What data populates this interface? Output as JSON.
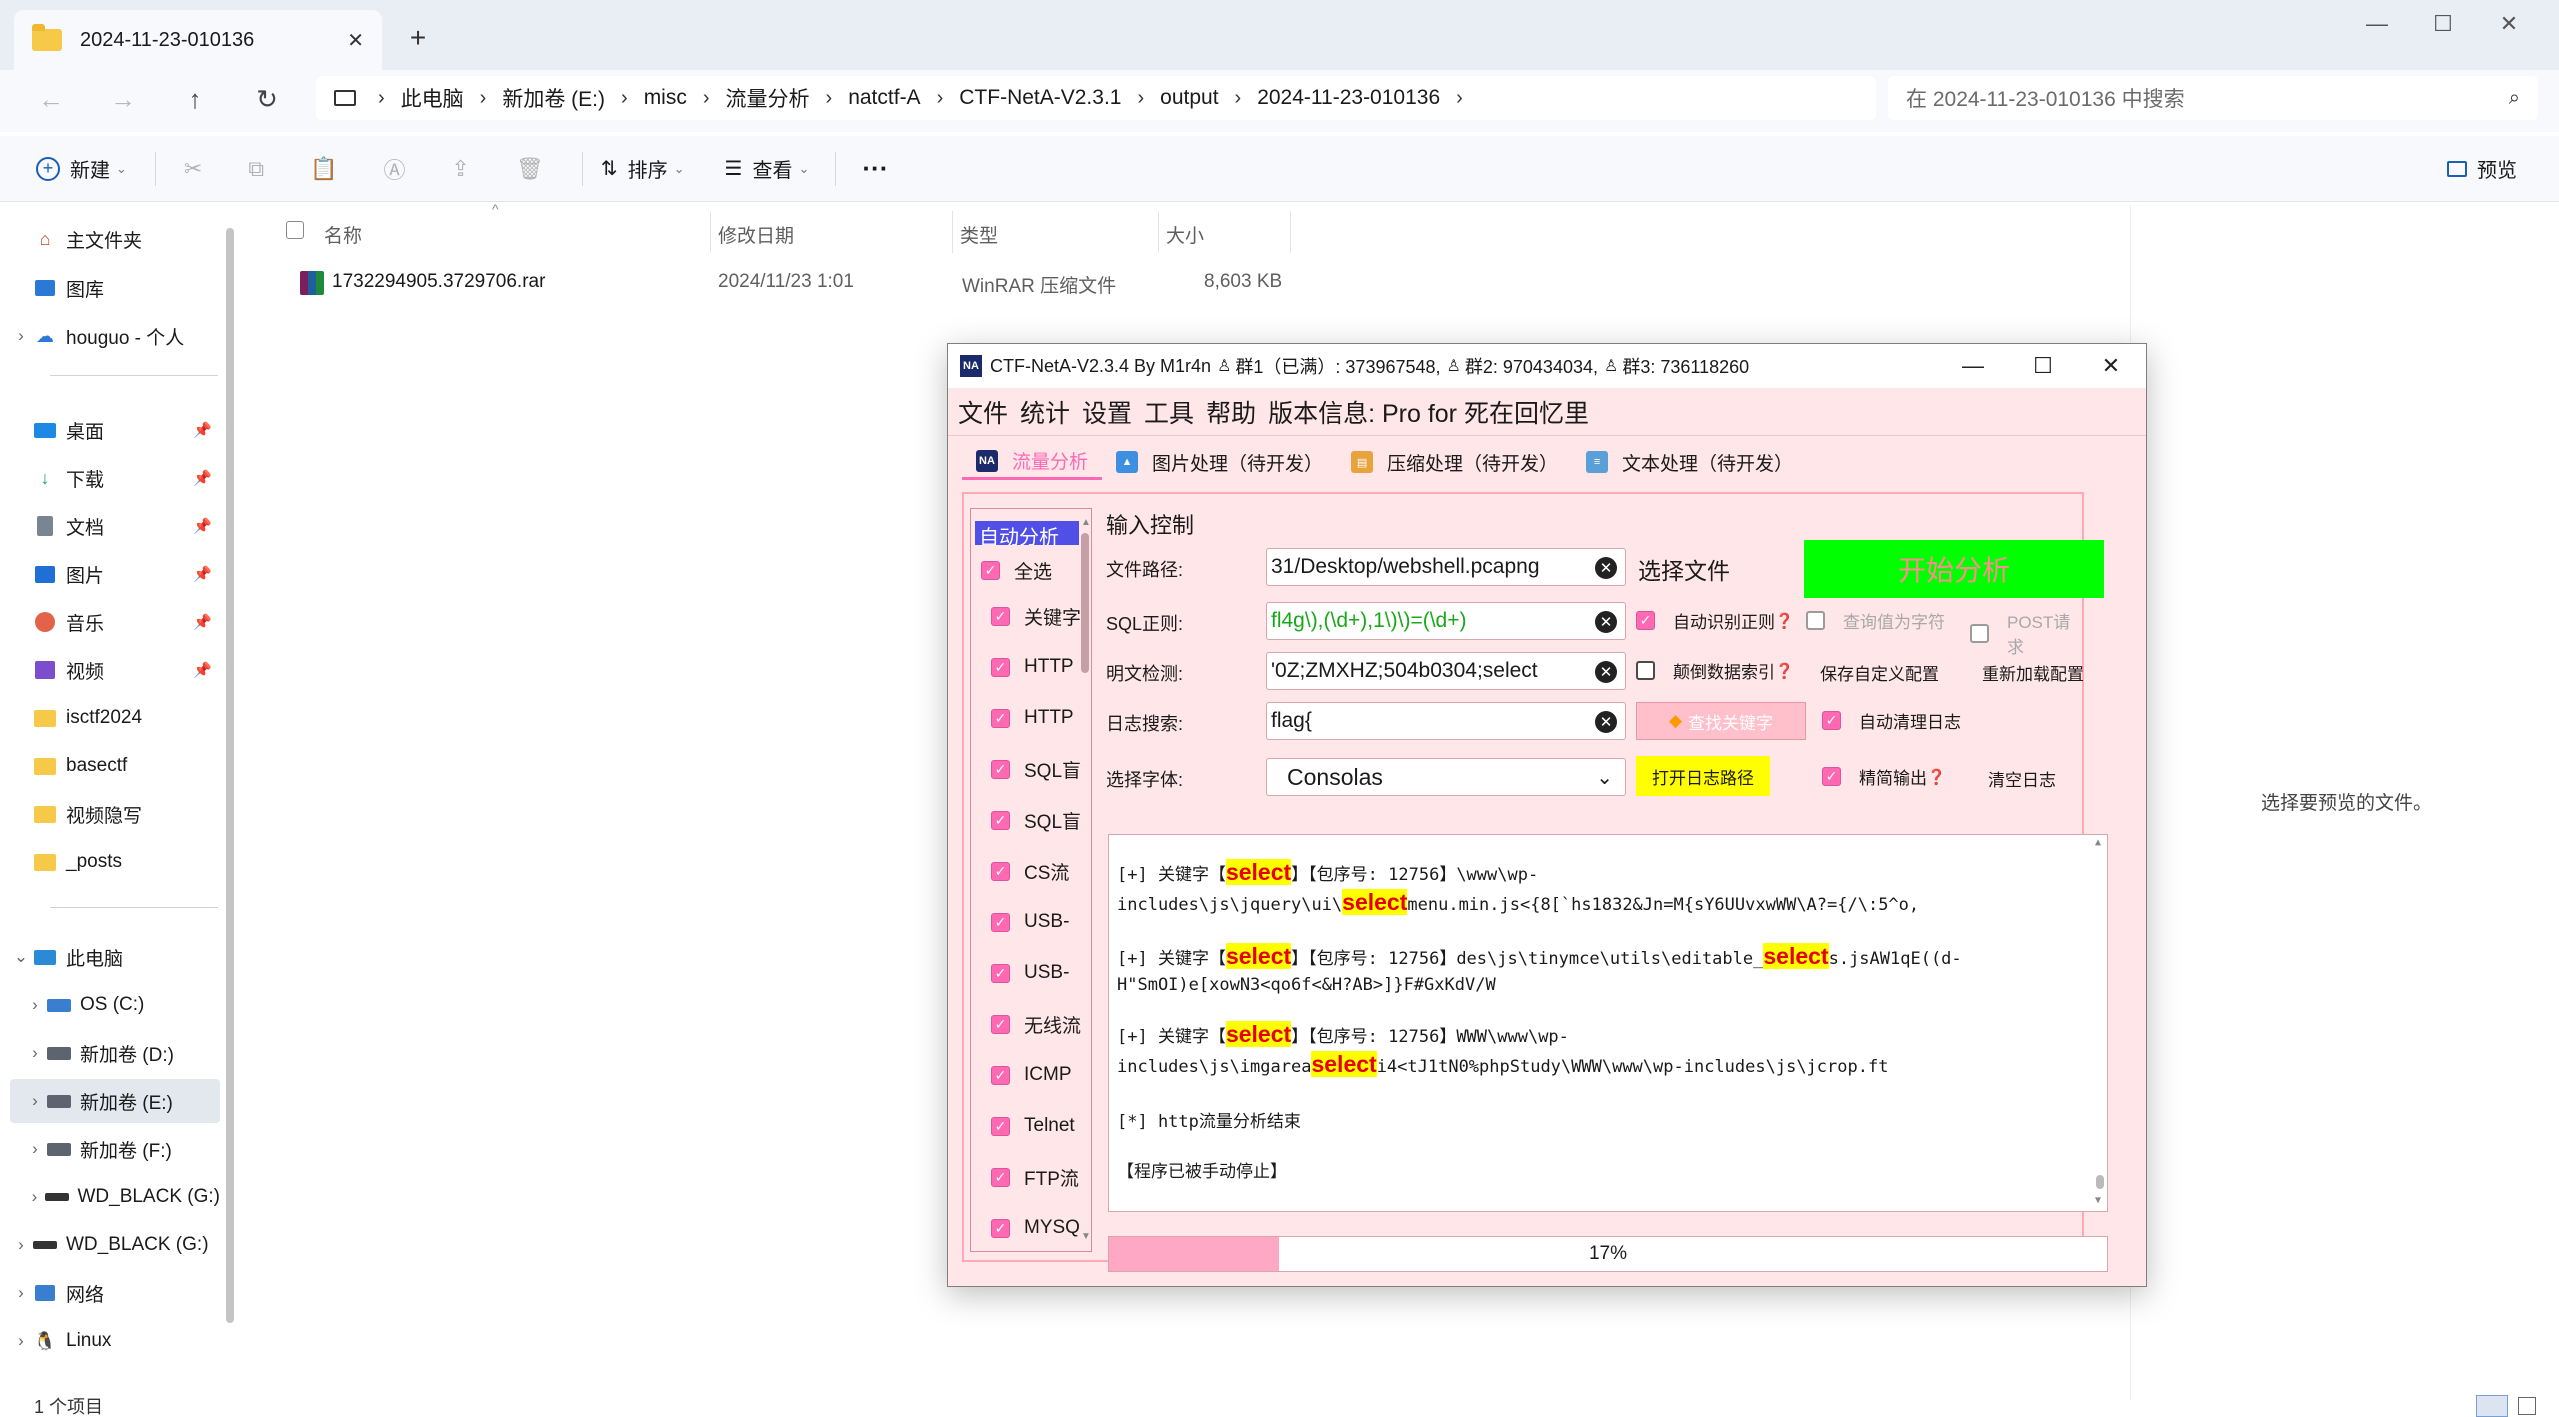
{
  "explorer": {
    "tab_title": "2024-11-23-010136",
    "breadcrumb": [
      "此电脑",
      "新加卷 (E:)",
      "misc",
      "流量分析",
      "natctf-A",
      "CTF-NetA-V2.3.1",
      "output",
      "2024-11-23-010136"
    ],
    "search_placeholder": "在 2024-11-23-010136 中搜索",
    "toolbar": {
      "new": "新建",
      "sort": "排序",
      "view": "查看",
      "more": "···",
      "preview": "预览"
    },
    "sidebar": {
      "top": [
        {
          "label": "主文件夹",
          "icon": "home-icon"
        },
        {
          "label": "图库",
          "icon": "gallery-icon"
        },
        {
          "label": "houguo - 个人",
          "icon": "cloud-icon"
        }
      ],
      "quick": [
        {
          "label": "桌面",
          "icon": "desktop-icon"
        },
        {
          "label": "下载",
          "icon": "download-icon"
        },
        {
          "label": "文档",
          "icon": "document-icon"
        },
        {
          "label": "图片",
          "icon": "pictures-icon"
        },
        {
          "label": "音乐",
          "icon": "music-icon"
        },
        {
          "label": "视频",
          "icon": "video-icon"
        },
        {
          "label": "isctf2024",
          "icon": "folder-icon"
        },
        {
          "label": "basectf",
          "icon": "folder-icon"
        },
        {
          "label": "视频隐写",
          "icon": "folder-icon"
        },
        {
          "label": "_posts",
          "icon": "folder-icon"
        }
      ],
      "pc": "此电脑",
      "drives": [
        {
          "label": "OS (C:)"
        },
        {
          "label": "新加卷 (D:)"
        },
        {
          "label": "新加卷 (E:)"
        },
        {
          "label": "新加卷 (F:)"
        },
        {
          "label": "WD_BLACK (G:)"
        }
      ],
      "bottom": [
        {
          "label": "WD_BLACK (G:)"
        },
        {
          "label": "网络"
        },
        {
          "label": "Linux"
        }
      ]
    },
    "columns": {
      "name": "名称",
      "date": "修改日期",
      "type": "类型",
      "size": "大小"
    },
    "files": [
      {
        "name": "1732294905.3729706.rar",
        "date": "2024/11/23 1:01",
        "type": "WinRAR 压缩文件",
        "size": "8,603 KB"
      }
    ],
    "preview_text": "选择要预览的文件。",
    "status": "1 个项目"
  },
  "neta": {
    "title": "CTF-NetA-V2.3.4 By M1r4n",
    "groups": [
      "群1（已满）: 373967548,",
      "群2: 970434034,",
      "群3: 736118260"
    ],
    "menu": [
      "文件",
      "统计",
      "设置",
      "工具",
      "帮助",
      "版本信息: Pro for 死在回忆里"
    ],
    "tabs": [
      "流量分析",
      "图片处理（待开发）",
      "压缩处理（待开发）",
      "文本处理（待开发）"
    ],
    "options_title": "自动分析",
    "options": [
      "全选",
      "关键字",
      "HTTP",
      "HTTP",
      "SQL盲",
      "SQL盲",
      "CS流",
      "USB-",
      "USB-",
      "无线流",
      "ICMP",
      "Telnet",
      "FTP流",
      "MYSQ"
    ],
    "input_section": "输入控制",
    "file_path_label": "文件路径:",
    "file_path": "31/Desktop/webshell.pcapng",
    "choose_file": "选择文件",
    "start": "开始分析",
    "sql_label": "SQL正则:",
    "sql_regex": "fl4g\\),(\\d+),1\\)\\)=(\\d+)",
    "plain_label": "明文检测:",
    "plain_value": "'0Z;ZMXHZ;504b0304;select",
    "log_label": "日志搜索:",
    "log_value": "flag{",
    "font_label": "选择字体:",
    "font_value": "Consolas",
    "find_keyword": "查找关键字",
    "open_log": "打开日志路径",
    "auto_regex": "自动识别正则",
    "query_as_char": "查询值为字符",
    "post_request": "POST请求",
    "reverse_index": "颠倒数据索引",
    "save_config": "保存自定义配置",
    "reload_config": "重新加载配置",
    "auto_clear": "自动清理日志",
    "concise": "精简输出",
    "clear_log": "清空日志",
    "help_mark": "❓",
    "log": {
      "l1_pre": "[+] 关键字【",
      "kw": "select",
      "l1_mid": "】【包序号: 12756】\\www\\wp-",
      "l2_pre": "includes\\js\\jquery\\ui\\",
      "l2_post": "menu.min.js<{8[`hs1832&Jn=M{sY6UUvxwWW\\A?={/\\:5^o,",
      "l3_mid": "】【包序号: 12756】des\\js\\tinymce\\utils\\editable_",
      "l3_post": "s.jsAW1qE((d-",
      "l4": "H\"SmOI)e[xowN3<qo6f<&H?AB>]}F#GxKdV/W",
      "l5_mid": "】【包序号: 12756】WWW\\www\\wp-",
      "l6_pre": "includes\\js\\imgarea",
      "l6_post": "i4<tJ1tN0%phpStudy\\WWW\\www\\wp-includes\\js\\jcrop.ft",
      "l7": "[*] http流量分析结束",
      "l8": "【程序已被手动停止】"
    },
    "progress_label": "17%",
    "progress_value": 0.17
  }
}
